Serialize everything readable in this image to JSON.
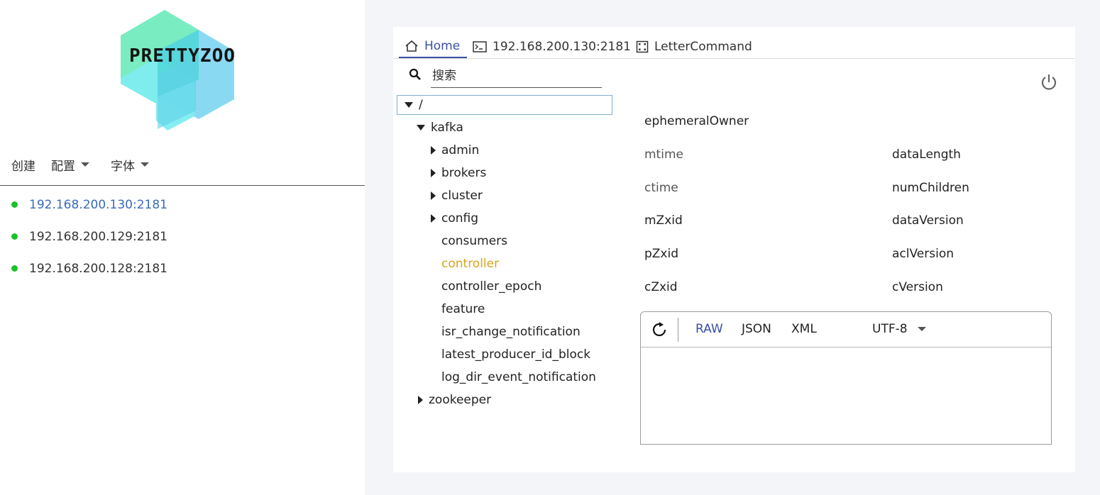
{
  "app": {
    "logo_text": "PRETTYZOO"
  },
  "menu": {
    "create": "创建",
    "config": "配置",
    "font": "字体"
  },
  "servers": [
    {
      "address": "192.168.200.130:2181",
      "status_color": "#1dc02c",
      "active": true
    },
    {
      "address": "192.168.200.129:2181",
      "status_color": "#1dc02c",
      "active": false
    },
    {
      "address": "192.168.200.128:2181",
      "status_color": "#1dc02c",
      "active": false
    }
  ],
  "tabs": {
    "home": "Home",
    "server": "192.168.200.130:2181",
    "letter": "LetterCommand"
  },
  "search": {
    "placeholder": "搜索"
  },
  "tree": {
    "root": "/",
    "kafka": "kafka",
    "children": [
      "admin",
      "brokers",
      "cluster",
      "config",
      "consumers",
      "controller",
      "controller_epoch",
      "feature",
      "isr_change_notification",
      "latest_producer_id_block",
      "log_dir_event_notification"
    ],
    "zookeeper": "zookeeper"
  },
  "stats": {
    "ephemeralOwner": "ephemeralOwner",
    "mtime": "mtime",
    "ctime": "ctime",
    "mZxid": "mZxid",
    "pZxid": "pZxid",
    "cZxid": "cZxid",
    "dataLength": "dataLength",
    "numChildren": "numChildren",
    "dataVersion": "dataVersion",
    "aclVersion": "aclVersion",
    "cVersion": "cVersion"
  },
  "editor": {
    "formats": [
      "RAW",
      "JSON",
      "XML"
    ],
    "active_format": "RAW",
    "encoding": "UTF-8"
  },
  "colors": {
    "accent": "#3a4fa6",
    "selected": "#d8a41c",
    "online": "#1dc02c"
  }
}
